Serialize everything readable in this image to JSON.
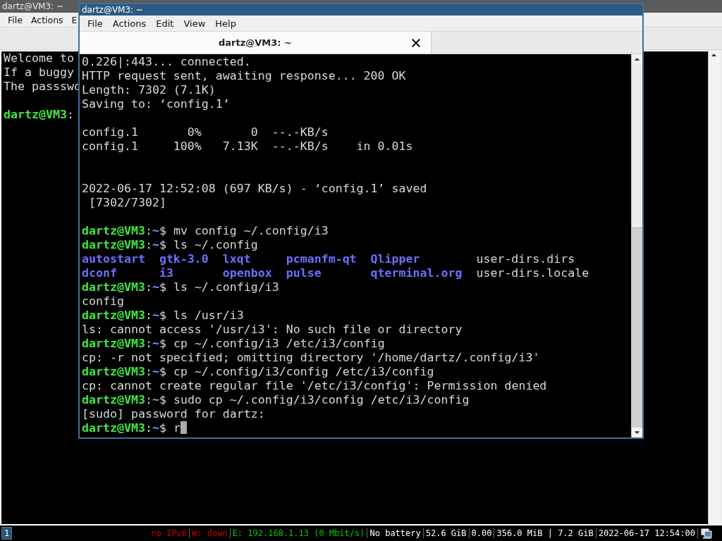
{
  "back_window": {
    "title": "dartz@VM3: ~",
    "menu": [
      "File",
      "Actions",
      "E"
    ],
    "lines": [
      {
        "kind": "output",
        "text": "Welcome to"
      },
      {
        "kind": "output",
        "text": "If a buggy"
      },
      {
        "kind": "output",
        "text": "The passswo"
      },
      {
        "kind": "blank"
      },
      {
        "kind": "prompt",
        "user": "dartz@VM3",
        "sep": ":"
      }
    ]
  },
  "front_window": {
    "title": "dartz@VM3: ~",
    "menu": [
      "File",
      "Actions",
      "Edit",
      "View",
      "Help"
    ],
    "tab": {
      "label": "dartz@VM3: ~"
    },
    "lines": [
      {
        "kind": "output",
        "text": "0.226|:443... connected."
      },
      {
        "kind": "output",
        "text": "HTTP request sent, awaiting response... 200 OK"
      },
      {
        "kind": "output",
        "text": "Length: 7302 (7.1K)"
      },
      {
        "kind": "output",
        "text": "Saving to: ‘config.1’"
      },
      {
        "kind": "blank"
      },
      {
        "kind": "output",
        "text": "config.1       0%       0  --.-KB/s"
      },
      {
        "kind": "output",
        "text": "config.1     100%   7.13K  --.-KB/s    in 0.01s"
      },
      {
        "kind": "blank"
      },
      {
        "kind": "blank"
      },
      {
        "kind": "output",
        "text": "2022-06-17 12:52:08 (697 KB/s) - ‘config.1’ saved"
      },
      {
        "kind": "output",
        "text": " [7302/7302]"
      },
      {
        "kind": "blank"
      },
      {
        "kind": "prompt",
        "user": "dartz@VM3",
        "sep": ":",
        "path": "~",
        "sign": "$",
        "command": "mv config ~/.config/i3"
      },
      {
        "kind": "prompt",
        "user": "dartz@VM3",
        "sep": ":",
        "path": "~",
        "sign": "$",
        "command": "ls ~/.config"
      },
      {
        "kind": "listing",
        "cells": [
          {
            "text": "autostart",
            "dir": true
          },
          {
            "text": "gtk-3.0",
            "dir": true
          },
          {
            "text": "lxqt",
            "dir": true
          },
          {
            "text": "pcmanfm-qt",
            "dir": true
          },
          {
            "text": "Qlipper",
            "dir": true
          },
          {
            "text": "user-dirs.dirs",
            "dir": false
          }
        ]
      },
      {
        "kind": "listing",
        "cells": [
          {
            "text": "dconf",
            "dir": true
          },
          {
            "text": "i3",
            "dir": true
          },
          {
            "text": "openbox",
            "dir": true
          },
          {
            "text": "pulse",
            "dir": true
          },
          {
            "text": "qterminal.org",
            "dir": true
          },
          {
            "text": "user-dirs.locale",
            "dir": false
          }
        ]
      },
      {
        "kind": "prompt",
        "user": "dartz@VM3",
        "sep": ":",
        "path": "~",
        "sign": "$",
        "command": "ls ~/.config/i3"
      },
      {
        "kind": "output",
        "text": "config"
      },
      {
        "kind": "prompt",
        "user": "dartz@VM3",
        "sep": ":",
        "path": "~",
        "sign": "$",
        "command": "ls /usr/i3"
      },
      {
        "kind": "output",
        "text": "ls: cannot access '/usr/i3': No such file or directory"
      },
      {
        "kind": "prompt",
        "user": "dartz@VM3",
        "sep": ":",
        "path": "~",
        "sign": "$",
        "command": "cp ~/.config/i3 /etc/i3/config"
      },
      {
        "kind": "output",
        "text": "cp: -r not specified; omitting directory '/home/dartz/.config/i3'"
      },
      {
        "kind": "prompt",
        "user": "dartz@VM3",
        "sep": ":",
        "path": "~",
        "sign": "$",
        "command": "cp ~/.config/i3/config /etc/i3/config"
      },
      {
        "kind": "output",
        "text": "cp: cannot create regular file '/etc/i3/config': Permission denied"
      },
      {
        "kind": "prompt",
        "user": "dartz@VM3",
        "sep": ":",
        "path": "~",
        "sign": "$",
        "command": "sudo cp ~/.config/i3/config /etc/i3/config"
      },
      {
        "kind": "output",
        "text": "[sudo] password for dartz:"
      },
      {
        "kind": "prompt",
        "user": "dartz@VM3",
        "sep": ":",
        "path": "~",
        "sign": "$",
        "command": "r",
        "cursor": true
      }
    ]
  },
  "status_bar": {
    "workspaces": [
      {
        "label": "1",
        "selected": true
      }
    ],
    "items": [
      {
        "text": "no IPv6",
        "color": "#cc0000"
      },
      {
        "text": "W: down",
        "color": "#cc0000"
      },
      {
        "text": "E: 192.168.1.13 (0 Mbit/s)",
        "color": "#00cc00"
      },
      {
        "text": "No battery",
        "color": "#ffffff"
      },
      {
        "text": "52.6 GiB",
        "color": "#ffffff"
      },
      {
        "text": "0.00",
        "color": "#ffffff"
      },
      {
        "text": "356.0 MiB | 7.2 GiB",
        "color": "#ffffff"
      },
      {
        "text": "2022-06-17 12:54:00",
        "color": "#ffffff"
      }
    ]
  }
}
